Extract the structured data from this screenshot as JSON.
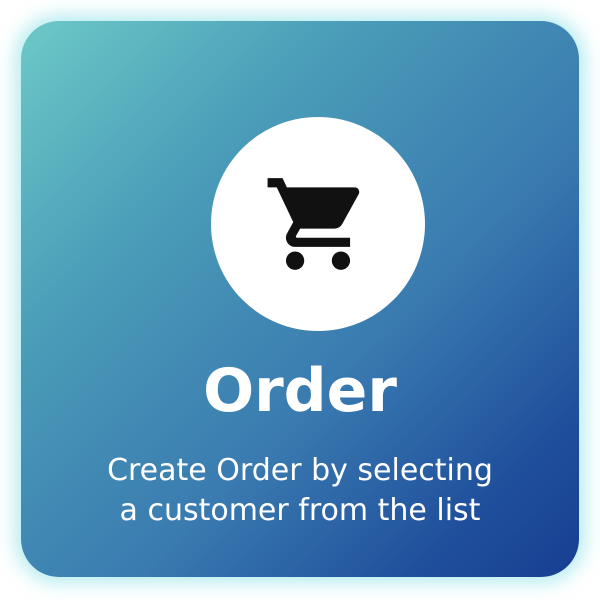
{
  "card": {
    "title": "Order",
    "description_line1": "Create Order by selecting",
    "description_line2": "a customer from the list",
    "icon": "shopping-cart-icon",
    "gradient_start": "#6cc9c7",
    "gradient_end": "#183e92",
    "text_color": "#ffffff",
    "icon_circle_color": "#ffffff",
    "icon_color": "#111111"
  }
}
